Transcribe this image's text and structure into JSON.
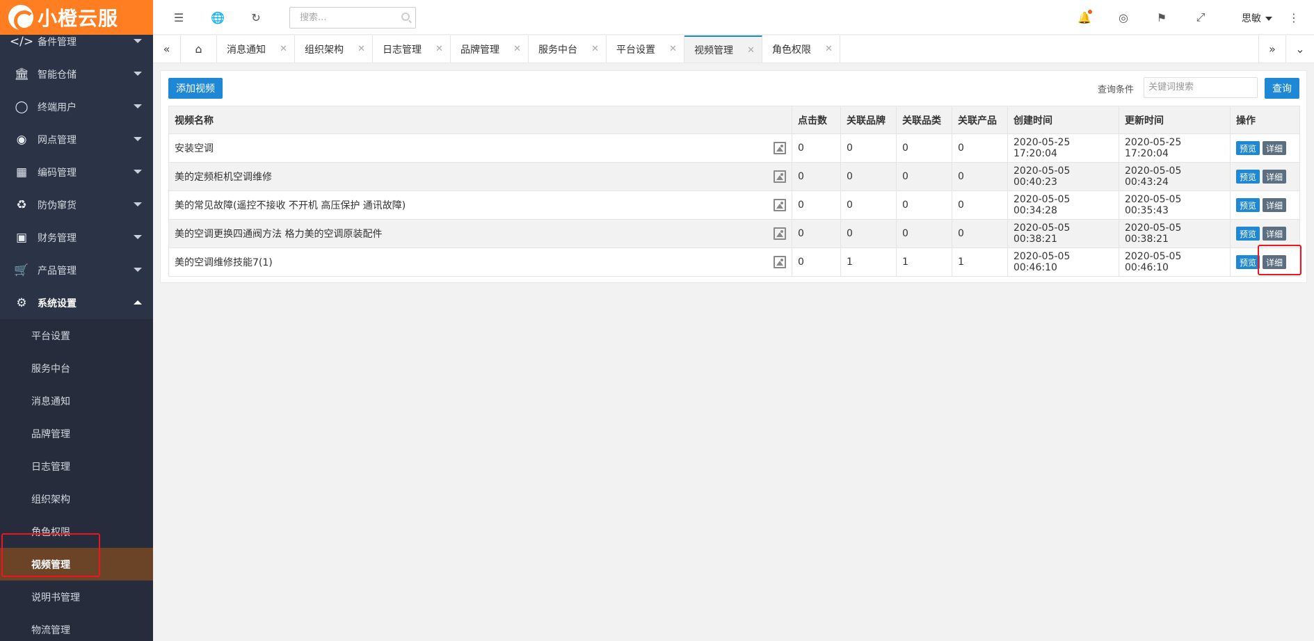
{
  "app": {
    "logo_text": "小橙云服"
  },
  "sidebar": {
    "items": [
      {
        "label": "备件管理",
        "icon": "code-icon"
      },
      {
        "label": "智能仓储",
        "icon": "bank-icon"
      },
      {
        "label": "终端用户",
        "icon": "user-icon"
      },
      {
        "label": "网点管理",
        "icon": "globe-icon"
      },
      {
        "label": "编码管理",
        "icon": "grid-icon"
      },
      {
        "label": "防伪窜货",
        "icon": "recycle-icon"
      },
      {
        "label": "财务管理",
        "icon": "money-icon"
      },
      {
        "label": "产品管理",
        "icon": "cart-icon"
      },
      {
        "label": "系统设置",
        "icon": "gear-icon"
      }
    ],
    "sub_items": [
      {
        "label": "平台设置"
      },
      {
        "label": "服务中台"
      },
      {
        "label": "消息通知"
      },
      {
        "label": "品牌管理"
      },
      {
        "label": "日志管理"
      },
      {
        "label": "组织架构"
      },
      {
        "label": "角色权限"
      },
      {
        "label": "视频管理"
      },
      {
        "label": "说明书管理"
      },
      {
        "label": "物流管理"
      }
    ]
  },
  "header": {
    "search_placeholder": "搜索...",
    "user_name": "思敏"
  },
  "tabs": [
    {
      "label": "消息通知"
    },
    {
      "label": "组织架构"
    },
    {
      "label": "日志管理"
    },
    {
      "label": "品牌管理"
    },
    {
      "label": "服务中台"
    },
    {
      "label": "平台设置"
    },
    {
      "label": "视频管理"
    },
    {
      "label": "角色权限"
    }
  ],
  "toolbar": {
    "add_label": "添加视频",
    "query_label": "查询条件",
    "query_placeholder": "关键词搜索",
    "query_button": "查询"
  },
  "table": {
    "headers": [
      "视频名称",
      "点击数",
      "关联品牌",
      "关联品类",
      "关联产品",
      "创建时间",
      "更新时间",
      "操作"
    ],
    "rows": [
      {
        "name": "安装空调",
        "clicks": "0",
        "brands": "0",
        "categories": "0",
        "products": "0",
        "created": "2020-05-25 17:20:04",
        "updated": "2020-05-25 17:20:04"
      },
      {
        "name": "美的定频柜机空调维修",
        "clicks": "0",
        "brands": "0",
        "categories": "0",
        "products": "0",
        "created": "2020-05-05 00:40:23",
        "updated": "2020-05-05 00:43:24"
      },
      {
        "name": "美的常见故障(遥控不接收 不开机 高压保护 通讯故障)",
        "clicks": "0",
        "brands": "0",
        "categories": "0",
        "products": "0",
        "created": "2020-05-05 00:34:28",
        "updated": "2020-05-05 00:35:43"
      },
      {
        "name": "美的空调更换四通阀方法 格力美的空调原装配件",
        "clicks": "0",
        "brands": "0",
        "categories": "0",
        "products": "0",
        "created": "2020-05-05 00:38:21",
        "updated": "2020-05-05 00:38:21"
      },
      {
        "name": "美的空调维修技能7(1)",
        "clicks": "0",
        "brands": "1",
        "categories": "1",
        "products": "1",
        "created": "2020-05-05 00:46:10",
        "updated": "2020-05-05 00:46:10"
      }
    ],
    "preview_label": "预览",
    "detail_label": "详细"
  },
  "colors": {
    "accent": "#1e88d7",
    "brand": "#ff7e21",
    "sidebar": "#2b3446",
    "active_sub": "#6b4428",
    "highlight": "#f0141e"
  }
}
